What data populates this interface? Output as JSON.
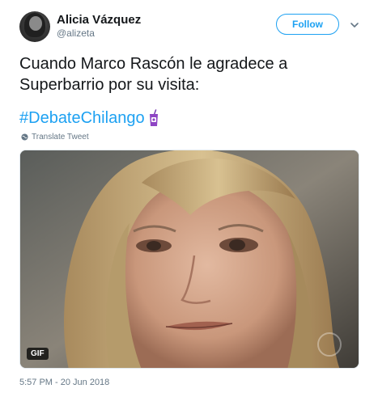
{
  "author": {
    "name": "Alicia Vázquez",
    "handle": "@alizeta"
  },
  "actions": {
    "follow_label": "Follow"
  },
  "tweet": {
    "text": "Cuando Marco Rascón le agradece a Superbarrio por su visita:",
    "hashtag": "#DebateChilango",
    "translate_label": "Translate Tweet",
    "timestamp": "5:57 PM - 20 Jun 2018"
  },
  "media": {
    "badge": "GIF"
  },
  "colors": {
    "accent": "#1da1f2",
    "text": "#14171a",
    "muted": "#657786"
  }
}
